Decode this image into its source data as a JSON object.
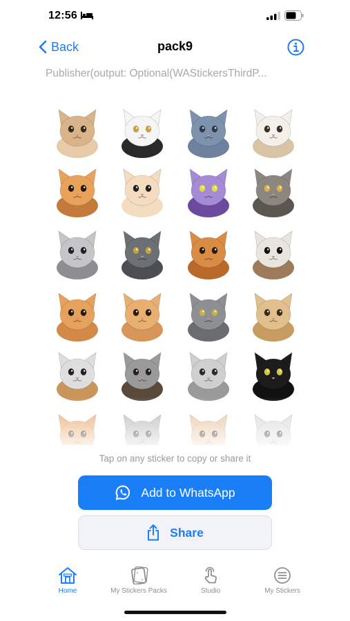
{
  "status_bar": {
    "time": "12:56"
  },
  "nav": {
    "back_label": "Back",
    "title": "pack9"
  },
  "publisher": "Publisher(output: Optional(WAStickersThirdP...",
  "stickers": [
    {
      "name": "sticker-cat-bear-hat",
      "fur": "#d9b48b",
      "bg": "#e7cba8",
      "eye": "#3a2a1a"
    },
    {
      "name": "sticker-tuxedo-cat",
      "fur": "#f5f5f5",
      "bg": "#2a2a2a",
      "eye": "#c9a04a"
    },
    {
      "name": "sticker-blue-cat",
      "fur": "#7d92ad",
      "bg": "#6e82a0",
      "eye": "#2d3a4c"
    },
    {
      "name": "sticker-white-cat",
      "fur": "#f3efe9",
      "bg": "#d9c3a5",
      "eye": "#3b2e22"
    },
    {
      "name": "sticker-orange-hood-cat",
      "fur": "#e9a25b",
      "bg": "#c47a3a",
      "eye": "#2a1a0e"
    },
    {
      "name": "sticker-pixel-cat",
      "fur": "#f4dcc0",
      "bg": "#f4dcc0",
      "eye": "#222222"
    },
    {
      "name": "sticker-purple-hat-cat",
      "fur": "#a58ad6",
      "bg": "#6b4aa0",
      "eye": "#e0e03a"
    },
    {
      "name": "sticker-tabby-cat",
      "fur": "#8b8780",
      "bg": "#5a5650",
      "eye": "#d9b34a"
    },
    {
      "name": "sticker-silver-cat",
      "fur": "#c5c5c8",
      "bg": "#8e8e92",
      "eye": "#222222"
    },
    {
      "name": "sticker-grey-yawn-cat",
      "fur": "#6c6f73",
      "bg": "#4b4e52",
      "eye": "#c3a33a"
    },
    {
      "name": "sticker-orange-cat",
      "fur": "#d98c44",
      "bg": "#b9692a",
      "eye": "#2a1a0e"
    },
    {
      "name": "sticker-calico-glasses-cat",
      "fur": "#e8e4de",
      "bg": "#9c7a5a",
      "eye": "#111111"
    },
    {
      "name": "sticker-kitten-orange",
      "fur": "#e6a25c",
      "bg": "#d38a48",
      "eye": "#2a1a0e"
    },
    {
      "name": "sticker-kitten-walk",
      "fur": "#e8b070",
      "bg": "#d8955a",
      "eye": "#2a1a0e"
    },
    {
      "name": "sticker-grey-cat",
      "fur": "#8d8f92",
      "bg": "#6a6c70",
      "eye": "#c6b24a"
    },
    {
      "name": "sticker-cartoon-cat",
      "fur": "#e2c08e",
      "bg": "#c69c62",
      "eye": "#3a2a1a"
    },
    {
      "name": "sticker-fold-cat-basket",
      "fur": "#dedede",
      "bg": "#c9955a",
      "eye": "#222222"
    },
    {
      "name": "sticker-upside-cat",
      "fur": "#9a9a9a",
      "bg": "#5a4a3a",
      "eye": "#222222"
    },
    {
      "name": "sticker-silver-tabby",
      "fur": "#cfcfcf",
      "bg": "#9a9a9a",
      "eye": "#2a2a2a"
    },
    {
      "name": "sticker-black-cat",
      "fur": "#1c1c1c",
      "bg": "#111111",
      "eye": "#d4c63a"
    },
    {
      "name": "sticker-orange-peek",
      "fur": "#e7a967",
      "bg": "#f0c898",
      "eye": "#2a1a0e"
    },
    {
      "name": "sticker-grey-peek",
      "fur": "#b9b9bd",
      "bg": "#d6d6d9",
      "eye": "#2a2a2a"
    },
    {
      "name": "sticker-cream-peek",
      "fur": "#e8c39c",
      "bg": "#f1dac0",
      "eye": "#2a1a0e"
    },
    {
      "name": "sticker-white-peek",
      "fur": "#d9d9dc",
      "bg": "#e9e9ec",
      "eye": "#2a2a2a"
    }
  ],
  "hint": "Tap on any sticker to copy or share it",
  "buttons": {
    "whatsapp": "Add to WhatsApp",
    "share": "Share"
  },
  "tabs": [
    {
      "label": "Home",
      "icon": "home-icon",
      "active": true
    },
    {
      "label": "My Stickers Packs",
      "icon": "sticker-pack-icon",
      "active": false
    },
    {
      "label": "Studio",
      "icon": "tap-hand-icon",
      "active": false
    },
    {
      "label": "My Stickers",
      "icon": "list-icon",
      "active": false
    }
  ],
  "colors": {
    "accent": "#1a7ef7",
    "secondary_text": "#a8a8ad",
    "tab_inactive": "#8e8e93"
  }
}
